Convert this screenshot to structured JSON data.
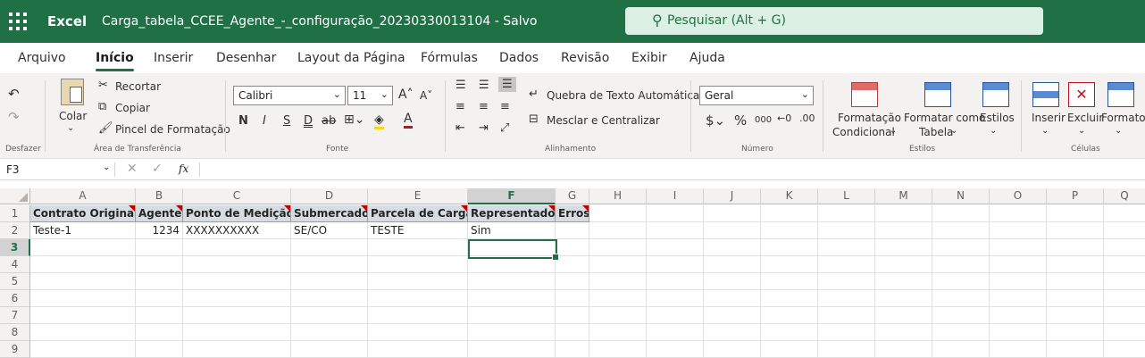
{
  "app": {
    "name": "Excel",
    "document_title": "Carga_tabela_CCEE_Agente_-_configuração_20230330013104 - Salvo"
  },
  "search": {
    "placeholder": "Pesquisar (Alt + G)"
  },
  "tabs": [
    "Arquivo",
    "Início",
    "Inserir",
    "Desenhar",
    "Layout da Página",
    "Fórmulas",
    "Dados",
    "Revisão",
    "Exibir",
    "Ajuda"
  ],
  "active_tab": "Início",
  "ribbon": {
    "undo_group": "Desfazer",
    "clipboard": {
      "paste": "Colar",
      "cut": "Recortar",
      "copy": "Copiar",
      "format_painter": "Pincel de Formatação",
      "label": "Área de Transferência"
    },
    "font": {
      "name": "Calibri",
      "size": "11",
      "label": "Fonte",
      "bold": "N",
      "italic": "I",
      "underline": "S",
      "double_underline": "D",
      "strike": "ab"
    },
    "alignment": {
      "wrap": "Quebra de Texto Automática",
      "merge": "Mesclar e Centralizar",
      "label": "Alinhamento"
    },
    "number": {
      "format": "Geral",
      "label": "Número",
      "thousands": "000"
    },
    "styles": {
      "conditional": "Formatação Condicional",
      "cond_line1": "Formatação",
      "cond_line2": "Condicional",
      "as_table_line1": "Formatar como",
      "as_table_line2": "Tabela",
      "cell_styles": "Estilos",
      "label": "Estilos"
    },
    "cells": {
      "insert": "Inserir",
      "delete": "Excluir",
      "format": "Formato",
      "label": "Células"
    }
  },
  "formula_bar": {
    "name_box": "F3",
    "fx": "fx",
    "value": ""
  },
  "sheet": {
    "columns": [
      "A",
      "B",
      "C",
      "D",
      "E",
      "F",
      "G",
      "H",
      "I",
      "J",
      "K",
      "L",
      "M",
      "N",
      "O",
      "P",
      "Q"
    ],
    "rows": [
      "1",
      "2",
      "3",
      "4",
      "5",
      "6",
      "7",
      "8",
      "9"
    ],
    "headers": [
      "Contrato Original",
      "Agente",
      "Ponto de Medição",
      "Submercado",
      "Parcela de Carga",
      "Representado",
      "Erros"
    ],
    "row2": [
      "Teste-1",
      "1234",
      "XXXXXXXXXX",
      "SE/CO",
      "TESTE",
      "Sim",
      ""
    ],
    "selected_cell": "F3"
  },
  "colors": {
    "brand": "#1f7145",
    "header_fill": "#d6dce4",
    "comment_marker": "#c00000"
  }
}
